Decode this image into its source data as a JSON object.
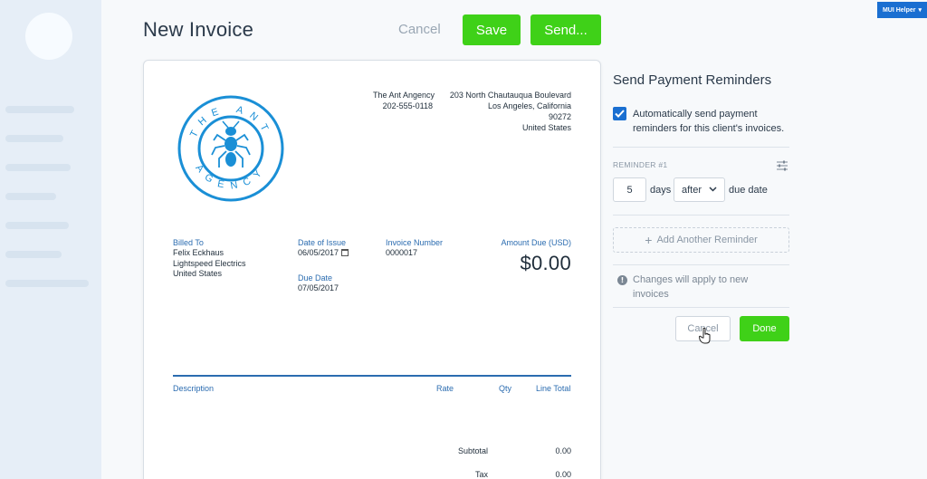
{
  "header": {
    "title": "New Invoice",
    "cancel_label": "Cancel",
    "save_label": "Save",
    "send_label": "Send..."
  },
  "helper_badge": "MUI Helper",
  "logo": {
    "top_text": "THE ANT",
    "bottom_text": "AGENCY",
    "color": "#1a8fd6"
  },
  "company": {
    "name": "The Ant Angency",
    "phone": "202-555-0118",
    "address_lines": [
      "203 North Chautauqua Boulevard",
      "Los Angeles, California",
      "90272",
      "United States"
    ]
  },
  "invoice": {
    "billed_to_label": "Billed To",
    "billed_to_lines": [
      "Felix Eckhaus",
      "Lightspeed Electrics",
      "United States"
    ],
    "date_of_issue_label": "Date of Issue",
    "date_of_issue": "06/05/2017",
    "due_date_label": "Due Date",
    "due_date": "07/05/2017",
    "invoice_number_label": "Invoice Number",
    "invoice_number": "0000017",
    "amount_due_label": "Amount Due (USD)",
    "amount_due": "$0.00"
  },
  "table": {
    "columns": [
      "Description",
      "Rate",
      "Qty",
      "Line Total"
    ],
    "subtotal_label": "Subtotal",
    "subtotal": "0.00",
    "tax_label": "Tax",
    "tax": "0.00"
  },
  "reminders": {
    "title": "Send Payment Reminders",
    "auto_checked": true,
    "auto_label": "Automatically send payment reminders for this client's invoices.",
    "reminder_label": "REMINDER #1",
    "days_value": "5",
    "days_text": "days",
    "timing_selected": "after",
    "due_text": "due date",
    "add_label": "Add Another Reminder",
    "info_text": "Changes will apply to new invoices",
    "cancel_label": "Cancel",
    "done_label": "Done"
  },
  "colors": {
    "green": "#3fd118",
    "blue": "#1a6fd1",
    "label_blue": "#2b6cb0"
  }
}
